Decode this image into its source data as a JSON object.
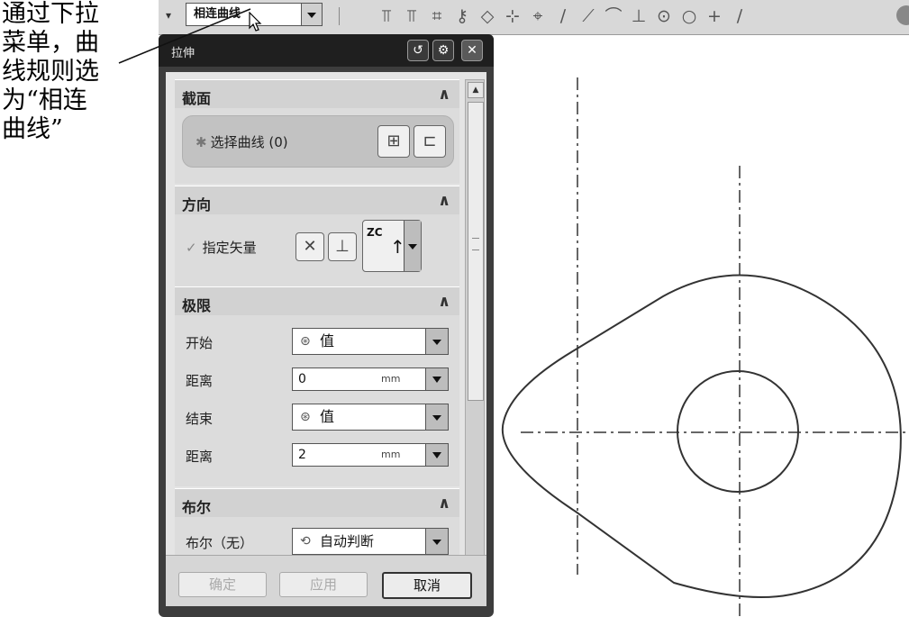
{
  "annotation": {
    "lines": [
      "通过下拉",
      "菜单，曲",
      "线规则选",
      "为“相连",
      "曲线”"
    ]
  },
  "toolbar": {
    "curve_rule_value": "相连曲线",
    "icons": [
      "constraint-icon",
      "constraint-icon",
      "grid-icon",
      "key-icon",
      "diamond-icon",
      "snap-icon",
      "snap-icon",
      "line-icon",
      "line-icon",
      "arc-icon",
      "point-icon",
      "circle-icon",
      "circle-icon",
      "plus-icon",
      "line-icon",
      "sphere-icon"
    ]
  },
  "dialog": {
    "title": "拉伸",
    "sections": {
      "section": {
        "header": "截面",
        "select_label": "选择曲线",
        "count": "(0)"
      },
      "direction": {
        "header": "方向",
        "vector_label": "指定矢量",
        "vector_option": "ZC"
      },
      "limits": {
        "header": "极限",
        "start_label": "开始",
        "start_value": "值",
        "start_distance_label": "距离",
        "start_distance": "0",
        "unit": "mm",
        "end_label": "结束",
        "end_value": "值",
        "end_distance_label": "距离",
        "end_distance": "2"
      },
      "boolean": {
        "header": "布尔",
        "label": "布尔（无）",
        "value": "自动判断"
      }
    },
    "buttons": {
      "ok": "确定",
      "apply": "应用",
      "cancel": "取消"
    }
  }
}
